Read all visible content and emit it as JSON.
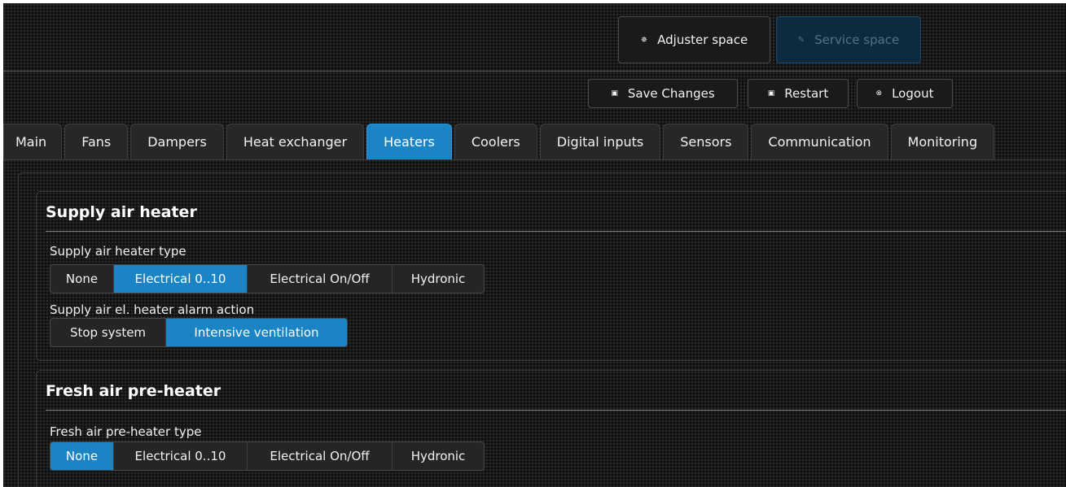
{
  "top": {
    "adjuster_label": "Adjuster space",
    "service_label": "Service space"
  },
  "actions": {
    "save_label": "Save Changes",
    "restart_label": "Restart",
    "logout_label": "Logout"
  },
  "tabs": [
    {
      "label": "Main"
    },
    {
      "label": "Fans"
    },
    {
      "label": "Dampers"
    },
    {
      "label": "Heat exchanger"
    },
    {
      "label": "Heaters",
      "active": true
    },
    {
      "label": "Coolers"
    },
    {
      "label": "Digital inputs"
    },
    {
      "label": "Sensors"
    },
    {
      "label": "Communication"
    },
    {
      "label": "Monitoring"
    }
  ],
  "sections": [
    {
      "title": "Supply air heater",
      "fields": [
        {
          "label": "Supply air heater type",
          "options": [
            "None",
            "Electrical 0..10",
            "Electrical On/Off",
            "Hydronic"
          ],
          "selected": "Electrical 0..10"
        },
        {
          "label": "Supply air el. heater alarm action",
          "options": [
            "Stop system",
            "Intensive ventilation"
          ],
          "selected": "Intensive ventilation"
        }
      ]
    },
    {
      "title": "Fresh air pre-heater",
      "fields": [
        {
          "label": "Fresh air pre-heater type",
          "options": [
            "None",
            "Electrical 0..10",
            "Electrical On/Off",
            "Hydronic"
          ],
          "selected": "None"
        }
      ]
    }
  ],
  "colors": {
    "accent": "#1a84c4",
    "service_bg": "#0e2a3e"
  },
  "icons": {
    "adjuster": "gear-icon",
    "service": "wrench-icon",
    "save": "floppy-icon",
    "restart": "restart-icon",
    "logout": "close-circle-icon"
  }
}
